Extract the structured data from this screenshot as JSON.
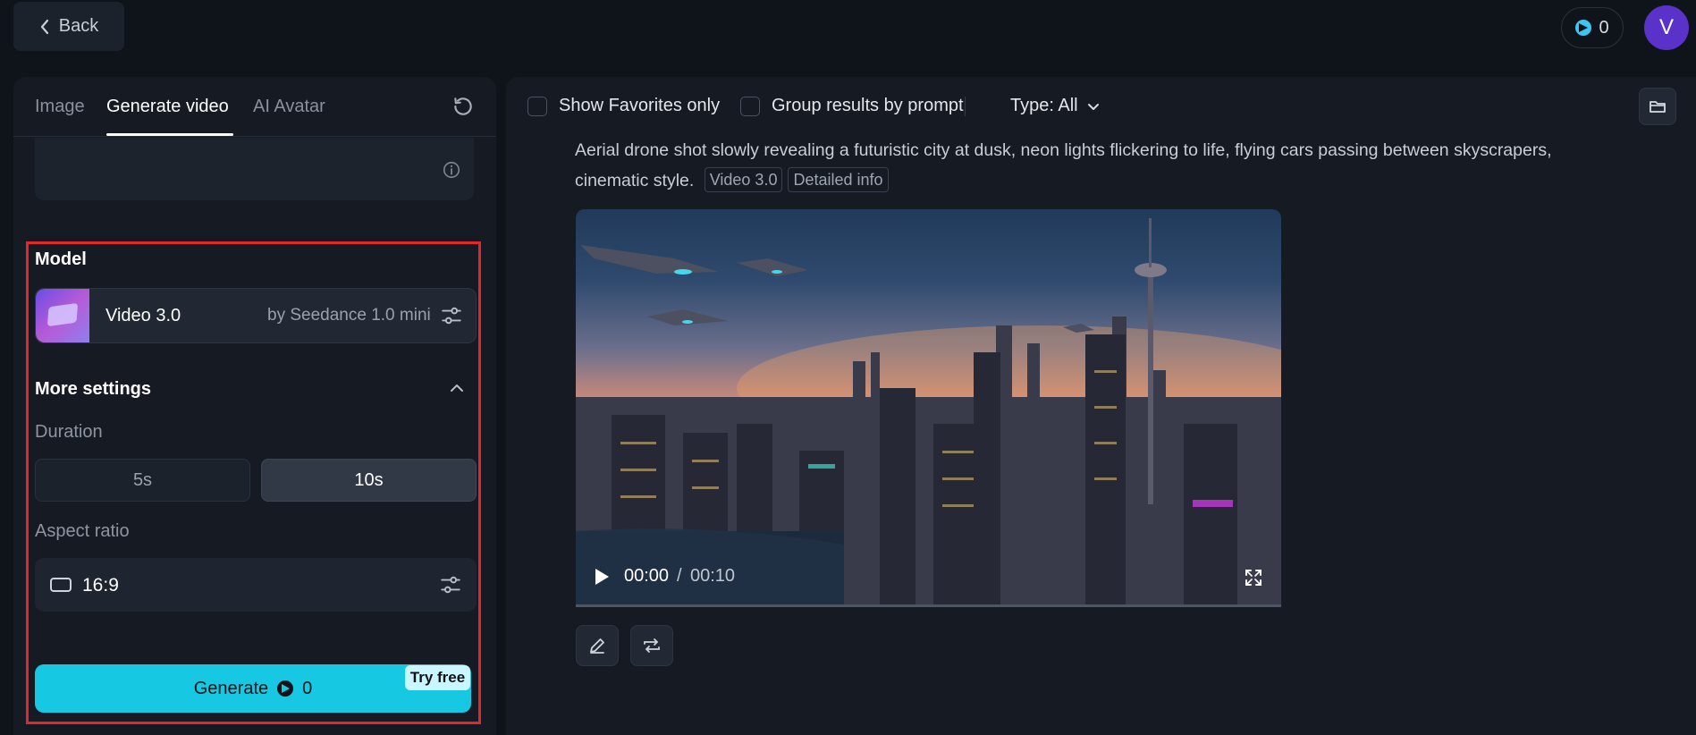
{
  "topbar": {
    "back_label": "Back",
    "credits": "0",
    "avatar_initial": "V"
  },
  "left": {
    "tabs": [
      {
        "label": "Image",
        "active": false
      },
      {
        "label": "Generate video",
        "active": true
      },
      {
        "label": "AI Avatar",
        "active": false
      }
    ],
    "model_title": "Model",
    "model": {
      "name": "Video 3.0",
      "by": "by Seedance 1.0 mini"
    },
    "more_settings": "More settings",
    "duration_label": "Duration",
    "durations": [
      {
        "label": "5s",
        "selected": false
      },
      {
        "label": "10s",
        "selected": true
      }
    ],
    "aspect_label": "Aspect ratio",
    "aspect_value": "16:9",
    "generate_label": "Generate",
    "generate_cost": "0",
    "try_free": "Try free",
    "highlight_color": "#e0282c",
    "accent_color": "#17c8e3"
  },
  "right": {
    "show_favorites": "Show Favorites only",
    "group_by_prompt": "Group results by prompt",
    "type_filter": "Type: All",
    "prompt": "Aerial drone shot slowly revealing a futuristic city at dusk, neon lights flickering to life, flying cars passing between skyscrapers, cinematic style.",
    "tags": [
      "Video 3.0",
      "Detailed info"
    ],
    "video": {
      "current_time": "00:00",
      "separator": "/",
      "total_time": "00:10"
    }
  }
}
